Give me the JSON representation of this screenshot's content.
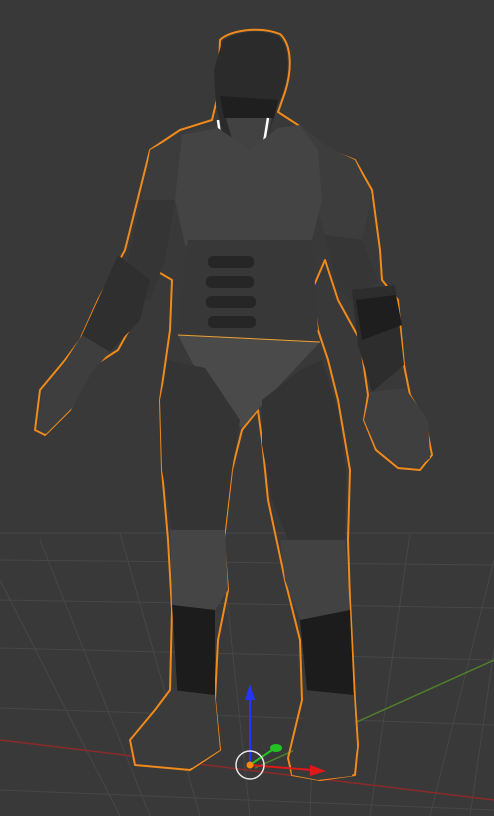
{
  "viewport": {
    "kind": "3d-viewport",
    "background_color": "#393939",
    "grid_color": "#4a4a4a",
    "x_axis_color": "#9a2a2a",
    "y_axis_color": "#4f8a2a",
    "selection_outline_color": "#f08a1a"
  },
  "scene_object": {
    "name": "armored-humanoid-model",
    "selected": true,
    "body_color": "#3a3a3a",
    "shade_color": "#262626",
    "highlight_color": "#5e5e5e"
  },
  "transform_gizmo": {
    "icon": "move-gizmo-icon",
    "z_color": "#2433ff",
    "y_color": "#22c422",
    "x_color": "#e01818",
    "origin_color": "#ff8a00"
  }
}
